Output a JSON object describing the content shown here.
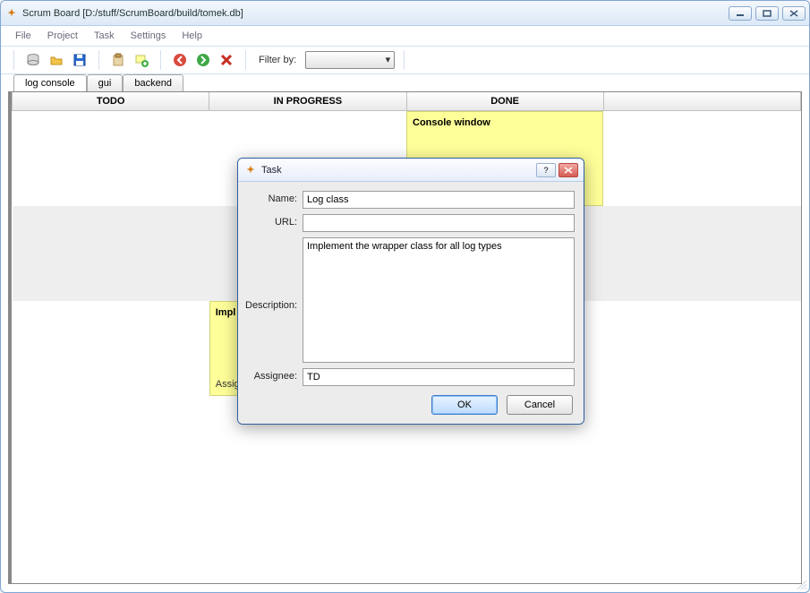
{
  "window": {
    "title": "Scrum Board [D:/stuff/ScrumBoard/build/tomek.db]"
  },
  "menubar": [
    "File",
    "Project",
    "Task",
    "Settings",
    "Help"
  ],
  "toolbar": {
    "filter_label": "Filter by:"
  },
  "tabs": [
    {
      "label": "log console",
      "active": true
    },
    {
      "label": "gui",
      "active": false
    },
    {
      "label": "backend",
      "active": false
    }
  ],
  "board": {
    "columns": [
      "TODO",
      "IN PROGRESS",
      "DONE"
    ],
    "cards": {
      "done_0": {
        "title": "Console window",
        "body": "",
        "assignee": ""
      },
      "inprogress_2_title_prefix": "Impl",
      "inprogress_2_assignee_prefix": "Assig"
    }
  },
  "dialog": {
    "title": "Task",
    "labels": {
      "name": "Name:",
      "url": "URL:",
      "description": "Description:",
      "assignee": "Assignee:"
    },
    "values": {
      "name": "Log class",
      "url": "",
      "description": "Implement the wrapper class for all log types",
      "assignee": "TD"
    },
    "buttons": {
      "ok": "OK",
      "cancel": "Cancel"
    }
  }
}
